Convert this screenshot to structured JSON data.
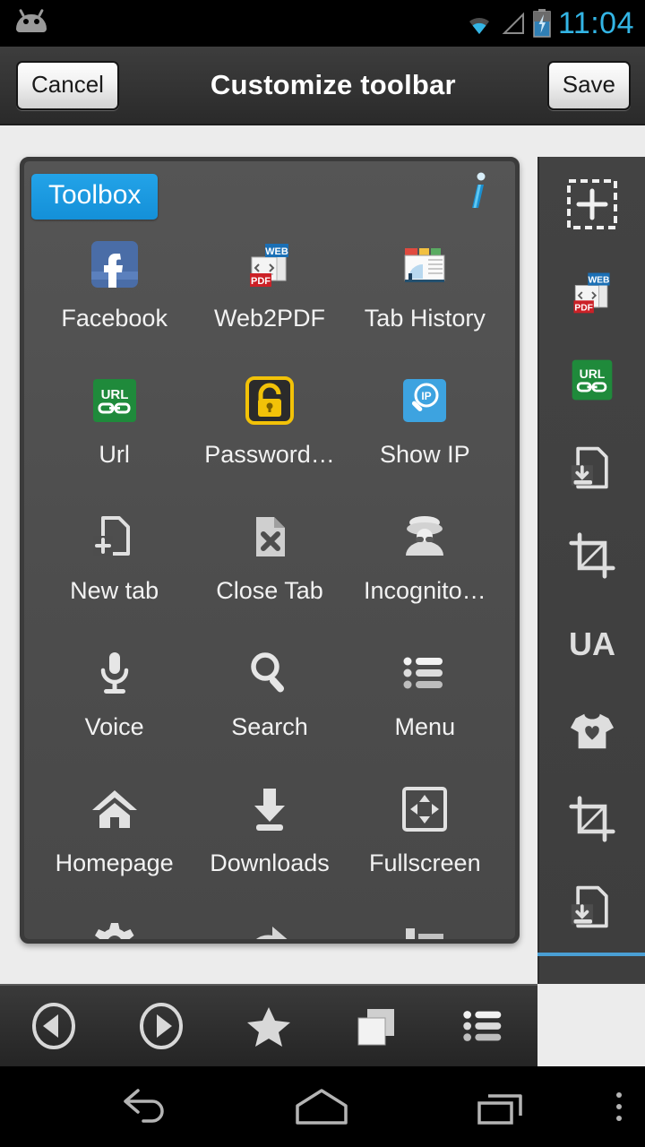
{
  "statusbar": {
    "time": "11:04",
    "icons": [
      "android-robot-icon",
      "wifi-icon",
      "signal-icon",
      "battery-charging-icon"
    ],
    "clock_color": "#33b5e5"
  },
  "titlebar": {
    "cancel_label": "Cancel",
    "title": "Customize toolbar",
    "save_label": "Save"
  },
  "panel": {
    "tab_label": "Toolbox",
    "tab_color": "#1490d8",
    "info_icon": "info-icon",
    "items": [
      {
        "label": "Facebook",
        "icon": "facebook-icon"
      },
      {
        "label": "Web2PDF",
        "icon": "web2pdf-icon"
      },
      {
        "label": "Tab History",
        "icon": "tab-history-icon"
      },
      {
        "label": "Url",
        "icon": "url-icon"
      },
      {
        "label": "Password…",
        "icon": "padlock-icon"
      },
      {
        "label": "Show IP",
        "icon": "show-ip-icon"
      },
      {
        "label": "New tab",
        "icon": "new-tab-icon"
      },
      {
        "label": "Close Tab",
        "icon": "close-tab-icon"
      },
      {
        "label": "Incognito…",
        "icon": "incognito-icon"
      },
      {
        "label": "Voice",
        "icon": "microphone-icon"
      },
      {
        "label": "Search",
        "icon": "magnifier-icon"
      },
      {
        "label": "Menu",
        "icon": "list-menu-icon"
      },
      {
        "label": "Homepage",
        "icon": "home-icon"
      },
      {
        "label": "Downloads",
        "icon": "download-icon"
      },
      {
        "label": "Fullscreen",
        "icon": "fullscreen-icon"
      },
      {
        "label": "",
        "icon": "gear-icon"
      },
      {
        "label": "",
        "icon": "share-icon"
      },
      {
        "label": "",
        "icon": "bar-list-icon"
      }
    ]
  },
  "sidebar": {
    "items": [
      {
        "icon": "add-dashed-icon"
      },
      {
        "icon": "web2pdf-icon"
      },
      {
        "icon": "url-icon"
      },
      {
        "icon": "save-page-icon"
      },
      {
        "icon": "crop-icon"
      },
      {
        "icon": "ua-icon",
        "label": "UA"
      },
      {
        "icon": "tshirt-heart-icon"
      },
      {
        "icon": "crop-icon"
      },
      {
        "icon": "save-page-icon"
      }
    ],
    "rule_color": "#4a9fd4"
  },
  "browser_toolbar": {
    "items": [
      {
        "icon": "back-circle-icon"
      },
      {
        "icon": "forward-circle-icon"
      },
      {
        "icon": "star-icon"
      },
      {
        "icon": "tabs-icon"
      },
      {
        "icon": "menu-list-icon"
      }
    ]
  },
  "navbar": {
    "items": [
      {
        "icon": "nav-back-icon"
      },
      {
        "icon": "nav-home-icon"
      },
      {
        "icon": "nav-recents-icon"
      },
      {
        "icon": "nav-overflow-icon"
      }
    ]
  }
}
